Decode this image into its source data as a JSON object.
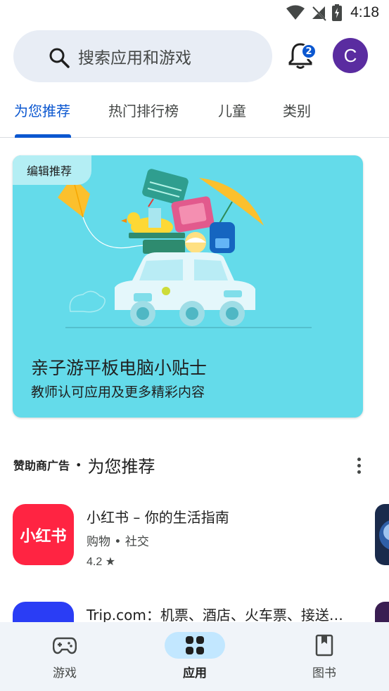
{
  "status_bar": {
    "time": "4:18"
  },
  "search": {
    "placeholder": "搜索应用和游戏",
    "notification_count": "2",
    "avatar_letter": "C"
  },
  "tabs": [
    {
      "label": "为您推荐",
      "active": true
    },
    {
      "label": "热门排行榜",
      "active": false
    },
    {
      "label": "儿童",
      "active": false
    },
    {
      "label": "类别",
      "active": false
    }
  ],
  "feature_card": {
    "badge": "编辑推荐",
    "title": "亲子游平板电脑小贴士",
    "subtitle": "教师认可应用及更多精彩内容"
  },
  "section": {
    "sponsor_label": "赞助商广告",
    "separator": "•",
    "title": "为您推荐"
  },
  "apps": [
    {
      "name": "小红书 – 你的生活指南",
      "category": "购物 • 社交",
      "rating": "4.2",
      "icon_text": "小红书",
      "icon_color": "#ff2442"
    },
    {
      "name": "Trip.com：机票、酒店、火车票、接送…",
      "icon_color": "#2a3df5"
    }
  ],
  "bottom_nav": [
    {
      "label": "游戏",
      "icon": "gamepad-icon",
      "active": false
    },
    {
      "label": "应用",
      "icon": "apps-grid-icon",
      "active": true
    },
    {
      "label": "图书",
      "icon": "book-icon",
      "active": false
    }
  ],
  "colors": {
    "accent": "#0b57d0",
    "card_bg": "#64dbea",
    "nav_bg": "#f0f4f9"
  }
}
